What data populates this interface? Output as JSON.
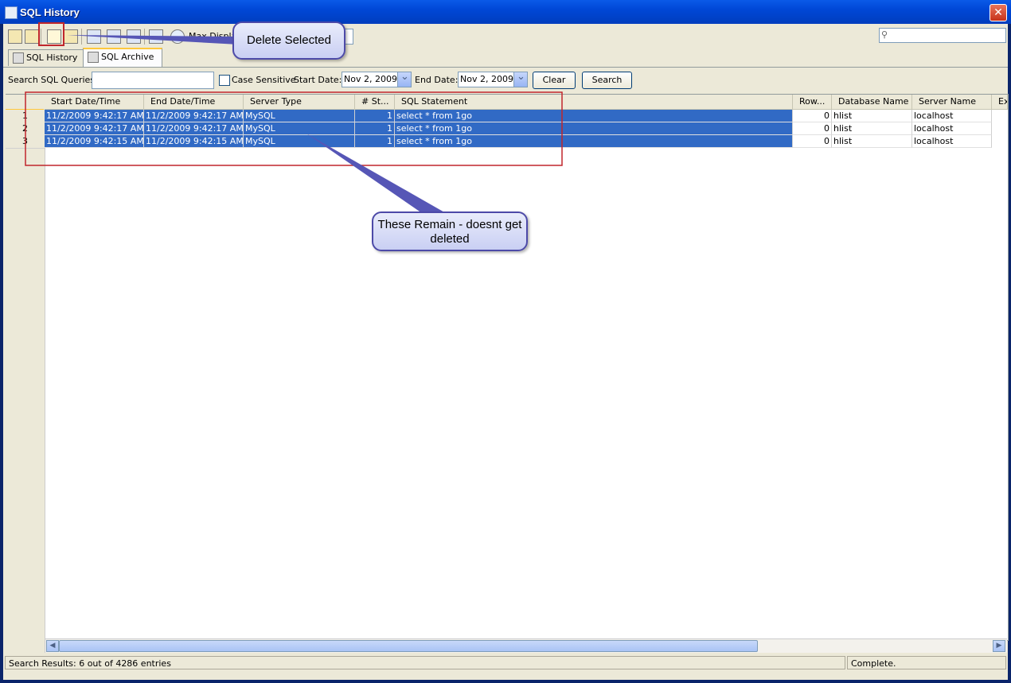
{
  "window": {
    "title": "SQL History",
    "close_label": "✕"
  },
  "toolbar": {
    "max_rows_label": "Max Display Rows:",
    "search_placeholder": ""
  },
  "tabs": [
    {
      "label": "SQL History",
      "active": false
    },
    {
      "label": "SQL Archive",
      "active": true
    }
  ],
  "search": {
    "queries_label": "Search SQL Queries:",
    "queries_value": "",
    "case_sensitive_label": "Case Sensitive",
    "case_sensitive_checked": false,
    "start_date_label": "Start Date:",
    "start_date_value": "Nov 2, 2009",
    "end_date_label": "End Date:",
    "end_date_value": "Nov 2, 2009",
    "clear_label": "Clear",
    "search_label": "Search"
  },
  "table": {
    "columns": [
      "Start Date/Time",
      "End Date/Time",
      "Server Type",
      "# St...",
      "SQL Statement",
      "Row...",
      "Database Name",
      "Server Name",
      "Ex"
    ],
    "rows": [
      {
        "num": "1",
        "start": "11/2/2009 9:42:17 AM",
        "end": "11/2/2009 9:42:17 AM",
        "server_type": "MySQL",
        "statements": "1",
        "sql": "select * from 1go",
        "rows": "0",
        "database": "hlist",
        "server": "localhost"
      },
      {
        "num": "2",
        "start": "11/2/2009 9:42:17 AM",
        "end": "11/2/2009 9:42:17 AM",
        "server_type": "MySQL",
        "statements": "1",
        "sql": "select * from 1go",
        "rows": "0",
        "database": "hlist",
        "server": "localhost"
      },
      {
        "num": "3",
        "start": "11/2/2009 9:42:15 AM",
        "end": "11/2/2009 9:42:15 AM",
        "server_type": "MySQL",
        "statements": "1",
        "sql": "select * from 1go",
        "rows": "0",
        "database": "hlist",
        "server": "localhost"
      }
    ]
  },
  "status": {
    "results": "Search Results: 6 out of 4286 entries",
    "state": "Complete."
  },
  "annotations": {
    "delete_callout": "Delete Selected",
    "remain_callout": "These Remain - doesnt get deleted",
    "highlight_color": "#c0262c",
    "callout_border": "#4d4aa8"
  },
  "colors": {
    "selection": "#316ac5",
    "titlebar": "#0047d6",
    "panel": "#ece9d8"
  }
}
